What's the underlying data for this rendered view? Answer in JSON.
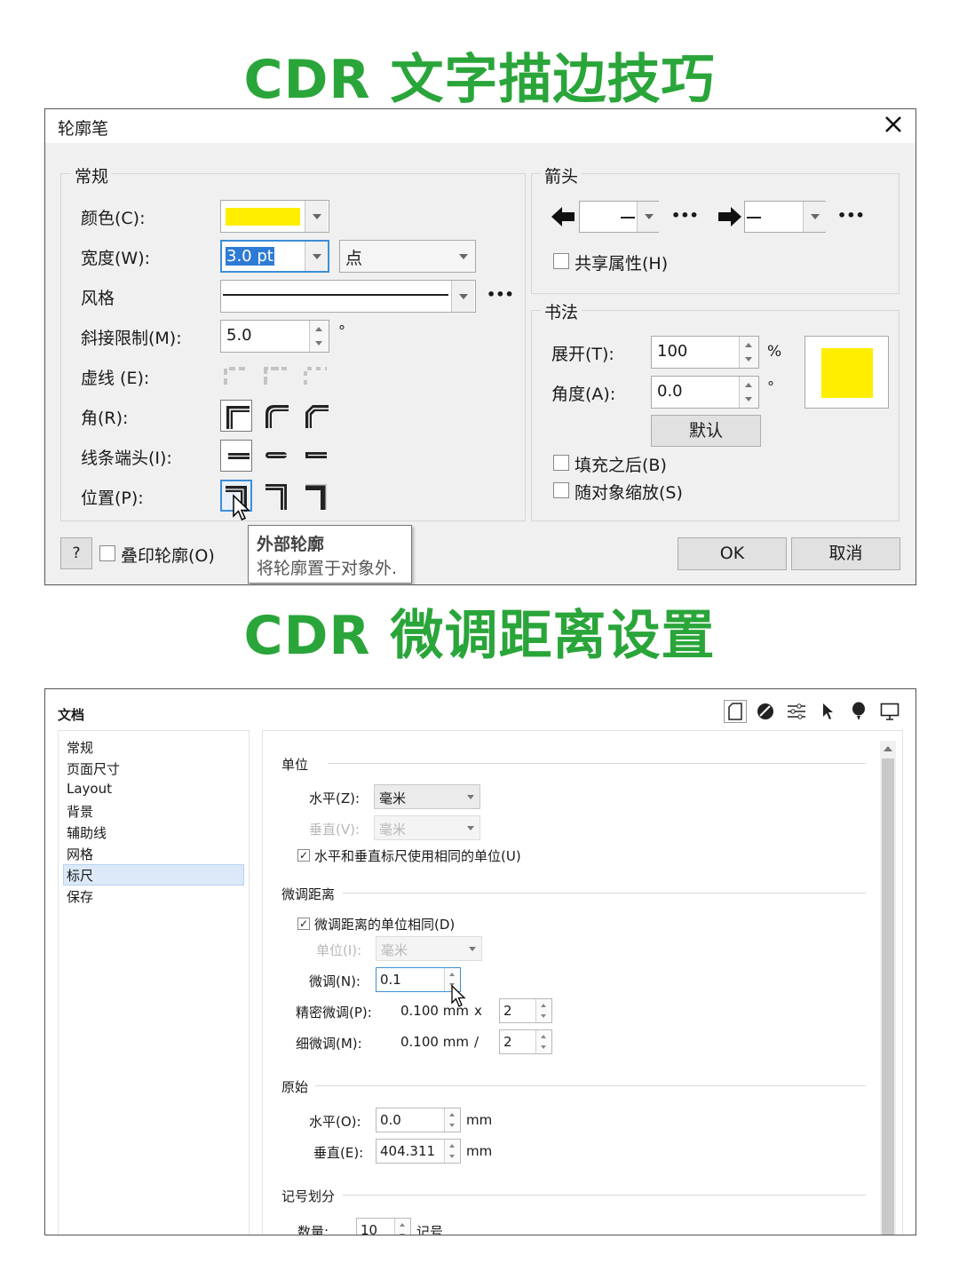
{
  "headline1": "CDR 文字描边技巧",
  "headline2": "CDR 微调距离设置",
  "outline_dialog": {
    "title": "轮廓笔",
    "general_group": "常规",
    "color_label": "颜色(C):",
    "color_value": "#ffee00",
    "width_label": "宽度(W):",
    "width_value": "3.0 pt",
    "unit_value": "点",
    "style_label": "风格",
    "miter_label": "斜接限制(M):",
    "miter_value": "5.0",
    "miter_unit": "°",
    "dash_label": "虚线 (E):",
    "corner_label": "角(R):",
    "cap_label": "线条端头(I):",
    "position_label": "位置(P):",
    "more": "•••",
    "arrow_group": "箭头",
    "share_label": "共享属性(H)",
    "calligraphy_group": "书法",
    "stretch_label": "展开(T):",
    "stretch_value": "100",
    "stretch_unit": "%",
    "angle_label": "角度(A):",
    "angle_value": "0.0",
    "angle_unit": "°",
    "default_btn": "默认",
    "fill_after_label": "填充之后(B)",
    "scale_label": "随对象缩放(S)",
    "help_btn": "?",
    "overprint_label": "叠印轮廓(O)",
    "tooltip_title": "外部轮廓",
    "tooltip_text": "将轮廓置于对象外.",
    "ok_btn": "OK",
    "cancel_btn": "取消"
  },
  "doc_dialog": {
    "title": "文档",
    "nav": [
      "常规",
      "页面尺寸",
      "Layout",
      "背景",
      "辅助线",
      "网格",
      "标尺",
      "保存"
    ],
    "nav_selected": "标尺",
    "units_section": "单位",
    "horizontal_label": "水平(Z):",
    "horizontal_value": "毫米",
    "vertical_label": "垂直(V):",
    "vertical_value": "毫米",
    "same_units_label": "水平和垂直标尺使用相同的单位(U)",
    "nudge_section": "微调距离",
    "nudge_same_label": "微调距离的单位相同(D)",
    "unit_label": "单位(I):",
    "unit_value": "毫米",
    "nudge_label": "微调(N):",
    "nudge_value": "0.1",
    "super_label": "精密微调(P):",
    "super_value": "0.100 mm",
    "super_op": "x",
    "super_num": "2",
    "micro_label": "细微调(M):",
    "micro_value": "0.100 mm",
    "micro_op": "/",
    "micro_num": "2",
    "origin_section": "原始",
    "origin_h_label": "水平(O):",
    "origin_h_value": "0.0",
    "origin_v_label": "垂直(E):",
    "origin_v_value": "404.311",
    "mm": "mm",
    "tick_section": "记号划分",
    "count_label": "数量:",
    "count_value": "10",
    "count_unit": "记号"
  }
}
